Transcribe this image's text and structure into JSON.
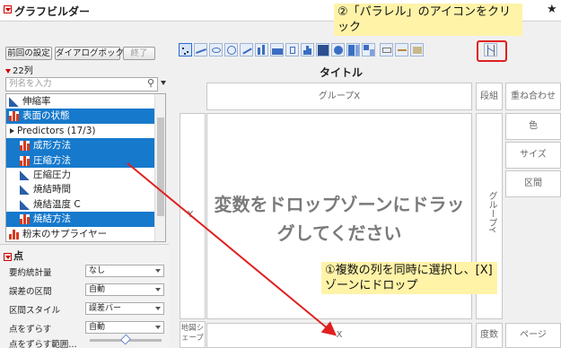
{
  "window": {
    "title": "グラフビルダー"
  },
  "buttons": {
    "prev_settings": "前回の設定",
    "dialog_box": "ダイアログボックス",
    "done": "終了"
  },
  "columns": {
    "count_label": "22列",
    "search_placeholder": "列名を入力",
    "items": [
      {
        "label": "伸縮率",
        "type": "continuous",
        "selected": false
      },
      {
        "label": "表面の状態",
        "type": "nominal",
        "selected": true
      },
      {
        "label": "Predictors (17/3)",
        "type": "group",
        "selected": false
      },
      {
        "label": "成形方法",
        "type": "nominal",
        "selected": true
      },
      {
        "label": "圧縮方法",
        "type": "nominal",
        "selected": true
      },
      {
        "label": "圧縮圧力",
        "type": "continuous",
        "selected": false
      },
      {
        "label": "焼結時間",
        "type": "continuous",
        "selected": false
      },
      {
        "label": "焼結温度 C",
        "type": "continuous",
        "selected": false
      },
      {
        "label": "焼結方法",
        "type": "nominal",
        "selected": true
      },
      {
        "label": "粉末のサプライヤー",
        "type": "nominal",
        "selected": false
      }
    ]
  },
  "point_section": {
    "header": "点",
    "props": [
      {
        "label": "要約統計量",
        "value": "なし"
      },
      {
        "label": "誤差の区間",
        "value": "自動"
      },
      {
        "label": "区間スタイル",
        "value": "誤差バー"
      },
      {
        "label": "点をずらす",
        "value": "自動"
      },
      {
        "label": "点をずらす範囲…",
        "value": ""
      }
    ]
  },
  "chart": {
    "title": "タイトル",
    "zones": {
      "group_x": "グループX",
      "wrap": "段組",
      "overlay": "重ね合わせ",
      "y": "Y",
      "color": "色",
      "size": "サイズ",
      "interval": "区間",
      "group_y": "グループY",
      "x": "X",
      "map_shape": "地図シェープ",
      "freq": "度数",
      "page": "ページ"
    },
    "drop_message": "変数をドロップゾーンにドラッグしてください"
  },
  "annotations": {
    "step1": "①複数の列を同時に選択し、[X]ゾーンにドロップ",
    "step2": "②「パラレル」のアイコンをクリック"
  },
  "icons": {
    "toolbar": [
      "points-icon",
      "smoother-icon",
      "ellipse-icon",
      "contour-icon",
      "line-icon",
      "bar-icon",
      "area-icon",
      "boxplot-icon",
      "histogram-icon",
      "heatmap-icon",
      "pie-icon",
      "treemap-icon",
      "mosaic-icon",
      "caption-box-icon",
      "formula-icon",
      "map-icon",
      "parallel-icon"
    ]
  },
  "colors": {
    "selection": "#1679cc",
    "nominal_icon": "#d83a1e",
    "continuous_icon": "#2a5ea8",
    "highlight": "#e02020",
    "callout_bg": "#fff3a8"
  }
}
